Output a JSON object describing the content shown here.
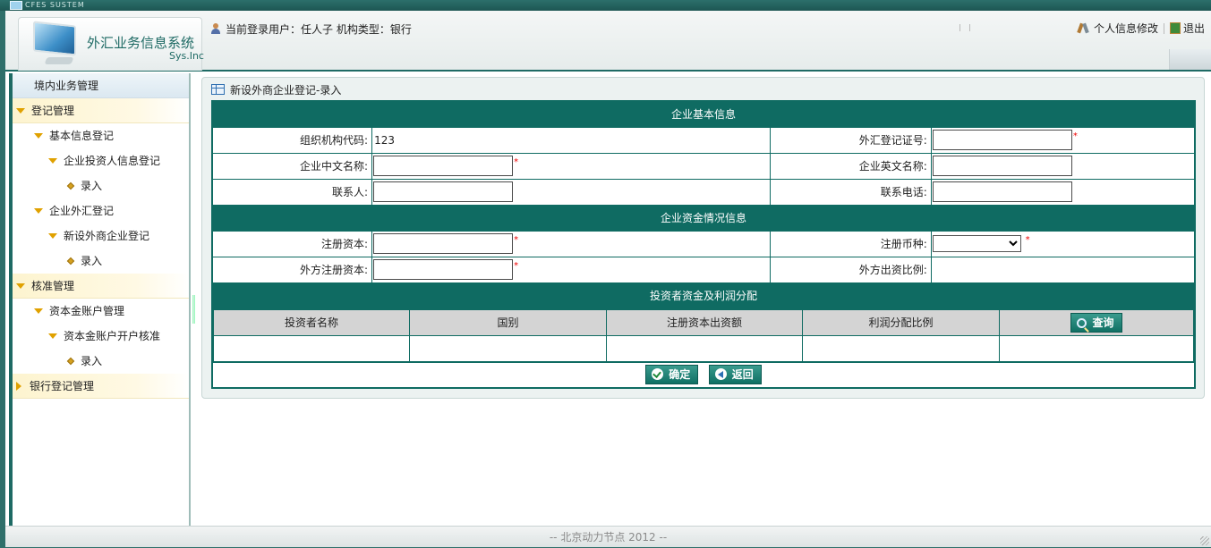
{
  "window": {
    "caption": "CFES SUSTEM"
  },
  "header": {
    "system_title": "外汇业务信息系统",
    "system_sub": "Sys.Inc",
    "login_info": "当前登录用户：任人子 机构类型：银行",
    "profile_link": "个人信息修改",
    "logout_link": "退出"
  },
  "sidebar": {
    "head": "境内业务管理",
    "items": [
      {
        "label": "登记管理",
        "level": 0,
        "marker": "tri-down"
      },
      {
        "label": "基本信息登记",
        "level": 1,
        "marker": "tri-down"
      },
      {
        "label": "企业投资人信息登记",
        "level": 2,
        "marker": "tri-down"
      },
      {
        "label": "录入",
        "level": 3,
        "marker": "diamond"
      },
      {
        "label": "企业外汇登记",
        "level": 1,
        "marker": "tri-down"
      },
      {
        "label": "新设外商企业登记",
        "level": 2,
        "marker": "tri-down"
      },
      {
        "label": "录入",
        "level": 3,
        "marker": "diamond"
      },
      {
        "label": "核准管理",
        "level": 0,
        "marker": "tri-down"
      },
      {
        "label": "资本金账户管理",
        "level": 1,
        "marker": "tri-down"
      },
      {
        "label": "资本金账户开户核准",
        "level": 2,
        "marker": "tri-down"
      },
      {
        "label": "录入",
        "level": 3,
        "marker": "diamond"
      },
      {
        "label": "银行登记管理",
        "level": 0,
        "marker": "tri-right"
      }
    ]
  },
  "panel": {
    "title": "新设外商企业登记-录入"
  },
  "form": {
    "section1": "企业基本信息",
    "org_code_label": "组织机构代码:",
    "org_code_value": "123",
    "fx_cert_label": "外汇登记证号:",
    "fx_cert_value": "",
    "cn_name_label": "企业中文名称:",
    "cn_name_value": "",
    "en_name_label": "企业英文名称:",
    "en_name_value": "",
    "contact_label": "联系人:",
    "contact_value": "",
    "phone_label": "联系电话:",
    "phone_value": "",
    "section2": "企业资金情况信息",
    "reg_capital_label": "注册资本:",
    "reg_capital_value": "",
    "currency_label": "注册币种:",
    "currency_value": "",
    "foreign_capital_label": "外方注册资本:",
    "foreign_capital_value": "",
    "foreign_ratio_label": "外方出资比例:",
    "foreign_ratio_value": "",
    "required_mark": "*",
    "section3": "投资者资金及利润分配",
    "investor_columns": [
      "投资者名称",
      "国别",
      "注册资本出资额",
      "利润分配比例"
    ],
    "query_button": "查询",
    "confirm_button": "确定",
    "back_button": "返回"
  },
  "footer": {
    "text": "-- 北京动力节点 2012 --"
  },
  "colors": {
    "accent": "#0f6b62",
    "frame": "#2f6f6a",
    "required": "#ee0000",
    "nav_marker": "#e0a100"
  }
}
